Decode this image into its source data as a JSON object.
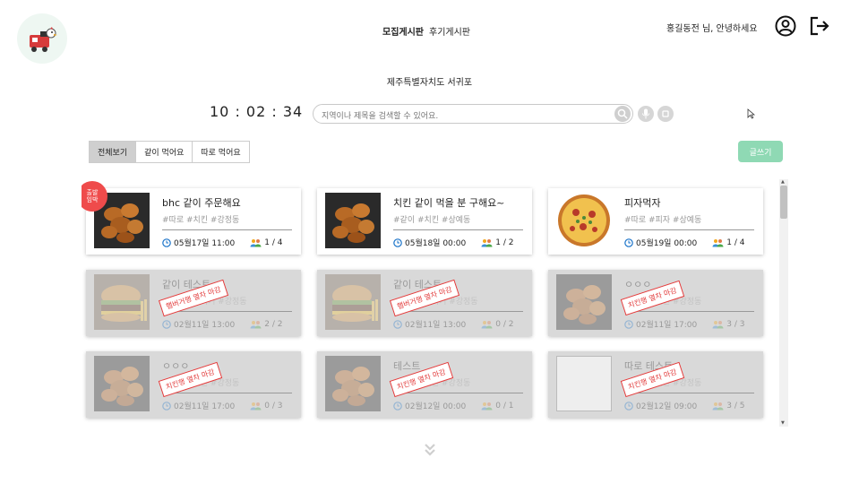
{
  "header": {
    "nav": [
      "모집게시판",
      "후기게시판"
    ],
    "greeting": "홍길동전 님, 안녕하세요",
    "location": "제주특별자치도 서귀포"
  },
  "clock": "10 : 02 : 34",
  "search": {
    "placeholder": "지역이나 제목을 검색할 수 있어요."
  },
  "tabs": [
    "전체보기",
    "같이 먹어요",
    "따로 먹어요"
  ],
  "write_label": "글쓰기",
  "cards": [
    {
      "title": "bhc 같이 주문해요",
      "tags": "#따로 #치킨 #강정동",
      "time": "05월17일 11:00",
      "people": "1 / 4",
      "badge": "출발\n임박",
      "stamp": "",
      "closed": false,
      "image": "chicken"
    },
    {
      "title": "치킨 같이 먹을 분 구해요~",
      "tags": "#같이 #치킨 #상예동",
      "time": "05월18일 00:00",
      "people": "1 / 2",
      "badge": "",
      "stamp": "",
      "closed": false,
      "image": "chicken"
    },
    {
      "title": "피자먹자",
      "tags": "#따로 #피자 #상예동",
      "time": "05월19일 00:00",
      "people": "1 / 4",
      "badge": "",
      "stamp": "",
      "closed": false,
      "image": "pizza"
    },
    {
      "title": "같이 테스트",
      "tags": "#같이 #햄버거 #강정동",
      "time": "02월11일 13:00",
      "people": "2 / 2",
      "badge": "",
      "stamp": "햄버거행 열차 마감",
      "closed": true,
      "image": "burger"
    },
    {
      "title": "같이 테스트",
      "tags": "#같이 #햄버거 #강정동",
      "time": "02월11일 13:00",
      "people": "0 / 2",
      "badge": "",
      "stamp": "햄버거행 열차 마감",
      "closed": true,
      "image": "burger"
    },
    {
      "title": "ㅇㅇㅇ",
      "tags": "#따로 #치킨 #강정동",
      "time": "02월11일 17:00",
      "people": "3 / 3",
      "badge": "",
      "stamp": "치킨행 열차 마감",
      "closed": true,
      "image": "chicken"
    },
    {
      "title": "ㅇㅇㅇ",
      "tags": "#따로 #치킨 #강정동",
      "time": "02월11일 17:00",
      "people": "0 / 3",
      "badge": "",
      "stamp": "치킨행 열차 마감",
      "closed": true,
      "image": "chicken"
    },
    {
      "title": "테스트",
      "tags": "#같이 #치킨 #강정동",
      "time": "02월12일 00:00",
      "people": "0 / 1",
      "badge": "",
      "stamp": "치킨행 열차 마감",
      "closed": true,
      "image": "chicken"
    },
    {
      "title": "따로 테스트",
      "tags": "#따로 #치킨 #강정동",
      "time": "02월12일 09:00",
      "people": "3 / 5",
      "badge": "",
      "stamp": "치킨행 열차 마감",
      "closed": true,
      "image": "broken"
    }
  ],
  "colors": {
    "accent": "#8fd9b4",
    "badge": "#ef4b4b",
    "stamp": "#e23b3b",
    "clock_icon": "#1a73c9"
  }
}
